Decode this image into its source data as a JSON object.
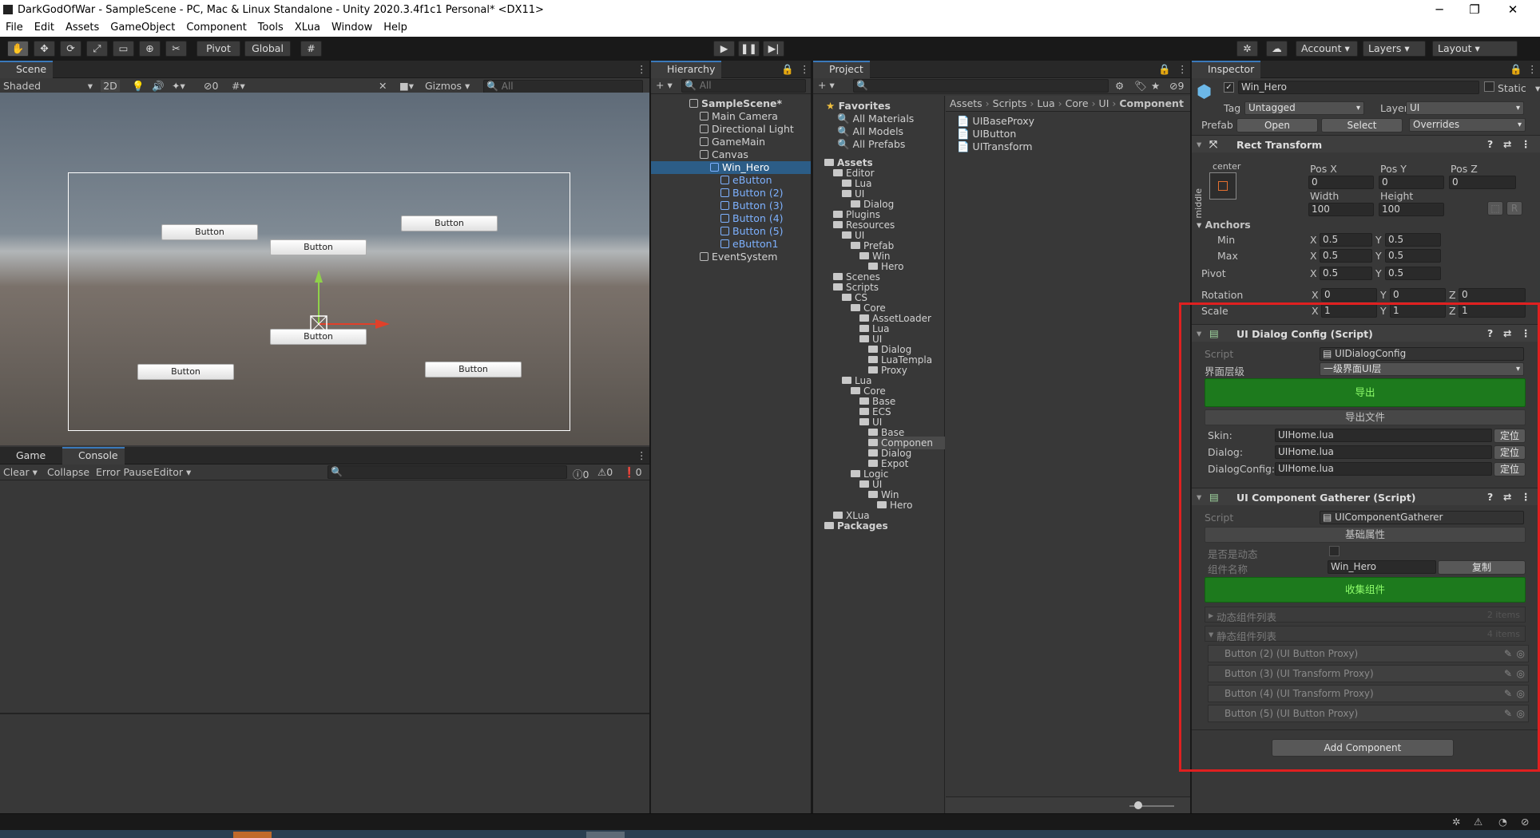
{
  "window": {
    "title": "DarkGodOfWar - SampleScene - PC, Mac & Linux Standalone - Unity 2020.3.4f1c1 Personal* <DX11>",
    "minimize": "─",
    "maximize": "❐",
    "close": "✕"
  },
  "menu": [
    "File",
    "Edit",
    "Assets",
    "GameObject",
    "Component",
    "Tools",
    "XLua",
    "Window",
    "Help"
  ],
  "toolbar": {
    "pivot": "Pivot",
    "global": "Global",
    "account": "Account",
    "layers": "Layers",
    "layout": "Layout"
  },
  "scene": {
    "tab": "Scene",
    "shading": "Shaded",
    "mode2d": "2D",
    "hidden_count": "0",
    "gizmos": "Gizmos",
    "search_placeholder": "All",
    "buttons": [
      "Button",
      "Button",
      "Button",
      "Button",
      "Button",
      "Button"
    ]
  },
  "bottom": {
    "tab_game": "Game",
    "tab_console": "Console",
    "clear": "Clear",
    "collapse": "Collapse",
    "error_pause": "Error Pause",
    "editor": "Editor",
    "count_log": "0",
    "count_warn": "0",
    "count_err": "0"
  },
  "hierarchy": {
    "tab": "Hierarchy",
    "search_placeholder": "All",
    "items": [
      {
        "label": "SampleScene*",
        "depth": 0
      },
      {
        "label": "Main Camera",
        "depth": 1
      },
      {
        "label": "Directional Light",
        "depth": 1
      },
      {
        "label": "GameMain",
        "depth": 1
      },
      {
        "label": "Canvas",
        "depth": 1
      },
      {
        "label": "Win_Hero",
        "depth": 2
      },
      {
        "label": "eButton",
        "depth": 3
      },
      {
        "label": "Button (2)",
        "depth": 3
      },
      {
        "label": "Button (3)",
        "depth": 3
      },
      {
        "label": "Button (4)",
        "depth": 3
      },
      {
        "label": "Button (5)",
        "depth": 3
      },
      {
        "label": "eButton1",
        "depth": 3
      },
      {
        "label": "EventSystem",
        "depth": 1
      }
    ]
  },
  "project": {
    "tab": "Project",
    "favorites": "Favorites",
    "fav_items": [
      "All Materials",
      "All Models",
      "All Prefabs"
    ],
    "tree": [
      {
        "label": "Assets",
        "d": 0,
        "b": true
      },
      {
        "label": "Editor",
        "d": 1
      },
      {
        "label": "Lua",
        "d": 2
      },
      {
        "label": "UI",
        "d": 2
      },
      {
        "label": "Dialog",
        "d": 3
      },
      {
        "label": "Plugins",
        "d": 1
      },
      {
        "label": "Resources",
        "d": 1
      },
      {
        "label": "UI",
        "d": 2
      },
      {
        "label": "Prefab",
        "d": 3
      },
      {
        "label": "Win",
        "d": 4
      },
      {
        "label": "Hero",
        "d": 5
      },
      {
        "label": "Scenes",
        "d": 1
      },
      {
        "label": "Scripts",
        "d": 1
      },
      {
        "label": "CS",
        "d": 2
      },
      {
        "label": "Core",
        "d": 3
      },
      {
        "label": "AssetLoader",
        "d": 4
      },
      {
        "label": "Lua",
        "d": 4
      },
      {
        "label": "UI",
        "d": 4
      },
      {
        "label": "Dialog",
        "d": 5
      },
      {
        "label": "LuaTempla",
        "d": 5
      },
      {
        "label": "Proxy",
        "d": 5
      },
      {
        "label": "Lua",
        "d": 2
      },
      {
        "label": "Core",
        "d": 3
      },
      {
        "label": "Base",
        "d": 4
      },
      {
        "label": "ECS",
        "d": 4
      },
      {
        "label": "UI",
        "d": 4
      },
      {
        "label": "Base",
        "d": 5
      },
      {
        "label": "Componen",
        "d": 5
      },
      {
        "label": "Dialog",
        "d": 5
      },
      {
        "label": "Expot",
        "d": 5
      },
      {
        "label": "Logic",
        "d": 3
      },
      {
        "label": "UI",
        "d": 4
      },
      {
        "label": "Win",
        "d": 5
      },
      {
        "label": "Hero",
        "d": 6
      },
      {
        "label": "XLua",
        "d": 1
      },
      {
        "label": "Packages",
        "d": 0,
        "b": true
      }
    ],
    "breadcrumb": [
      "Assets",
      "Scripts",
      "Lua",
      "Core",
      "UI",
      "Component"
    ],
    "files": [
      "UIBaseProxy",
      "UIButton",
      "UITransform"
    ],
    "hidden_count": "9"
  },
  "inspector": {
    "tab": "Inspector",
    "name": "Win_Hero",
    "static": "Static",
    "tag_label": "Tag",
    "tag": "Untagged",
    "layer_label": "Layer",
    "layer": "UI",
    "prefab_label": "Prefab",
    "open": "Open",
    "select": "Select",
    "overrides": "Overrides",
    "rect": {
      "title": "Rect Transform",
      "anchor_h": "center",
      "anchor_v": "middle",
      "posx_l": "Pos X",
      "posy_l": "Pos Y",
      "posz_l": "Pos Z",
      "posx": "0",
      "posy": "0",
      "posz": "0",
      "width_l": "Width",
      "height_l": "Height",
      "width": "100",
      "height": "100",
      "r": "R",
      "anchors": "Anchors",
      "min": "Min",
      "max": "Max",
      "pivot": "Pivot",
      "x": "X",
      "y": "Y",
      "z": "Z",
      "min_x": "0.5",
      "min_y": "0.5",
      "max_x": "0.5",
      "max_y": "0.5",
      "pivot_x": "0.5",
      "pivot_y": "0.5",
      "rotation": "Rotation",
      "rot_x": "0",
      "rot_y": "0",
      "rot_z": "0",
      "scale": "Scale",
      "sc_x": "1",
      "sc_y": "1",
      "sc_z": "1"
    },
    "dialog_cfg": {
      "title": "UI Dialog Config (Script)",
      "script_l": "Script",
      "script": "UIDialogConfig",
      "level_l": "界面层级",
      "level": "一级界面UI层",
      "export": "导出",
      "export_file": "导出文件",
      "skin_l": "Skin:",
      "skin": "UIHome.lua",
      "dialog_l": "Dialog:",
      "dialog": "UIHome.lua",
      "cfg_l": "DialogConfig:",
      "cfg": "UIHome.lua",
      "locate": "定位"
    },
    "gatherer": {
      "title": "UI Component Gatherer (Script)",
      "script_l": "Script",
      "script": "UIComponentGatherer",
      "basic": "基础属性",
      "dynamic_l": "是否是动态",
      "name_l": "组件名称",
      "name": "Win_Hero",
      "copy": "复制",
      "collect": "收集组件",
      "dyn_list": "动态组件列表",
      "dyn_count": "2 items",
      "static_list": "静态组件列表",
      "static_count": "4 items",
      "items": [
        "Button (2) (UI Button Proxy)",
        "Button (3) (UI Transform Proxy)",
        "Button (4) (UI Transform Proxy)",
        "Button (5) (UI Button Proxy)"
      ]
    },
    "add_component": "Add Component"
  },
  "colors": {
    "highlight": "#e02020",
    "accent": "#3a79bb",
    "green": "#1d7a1d"
  }
}
